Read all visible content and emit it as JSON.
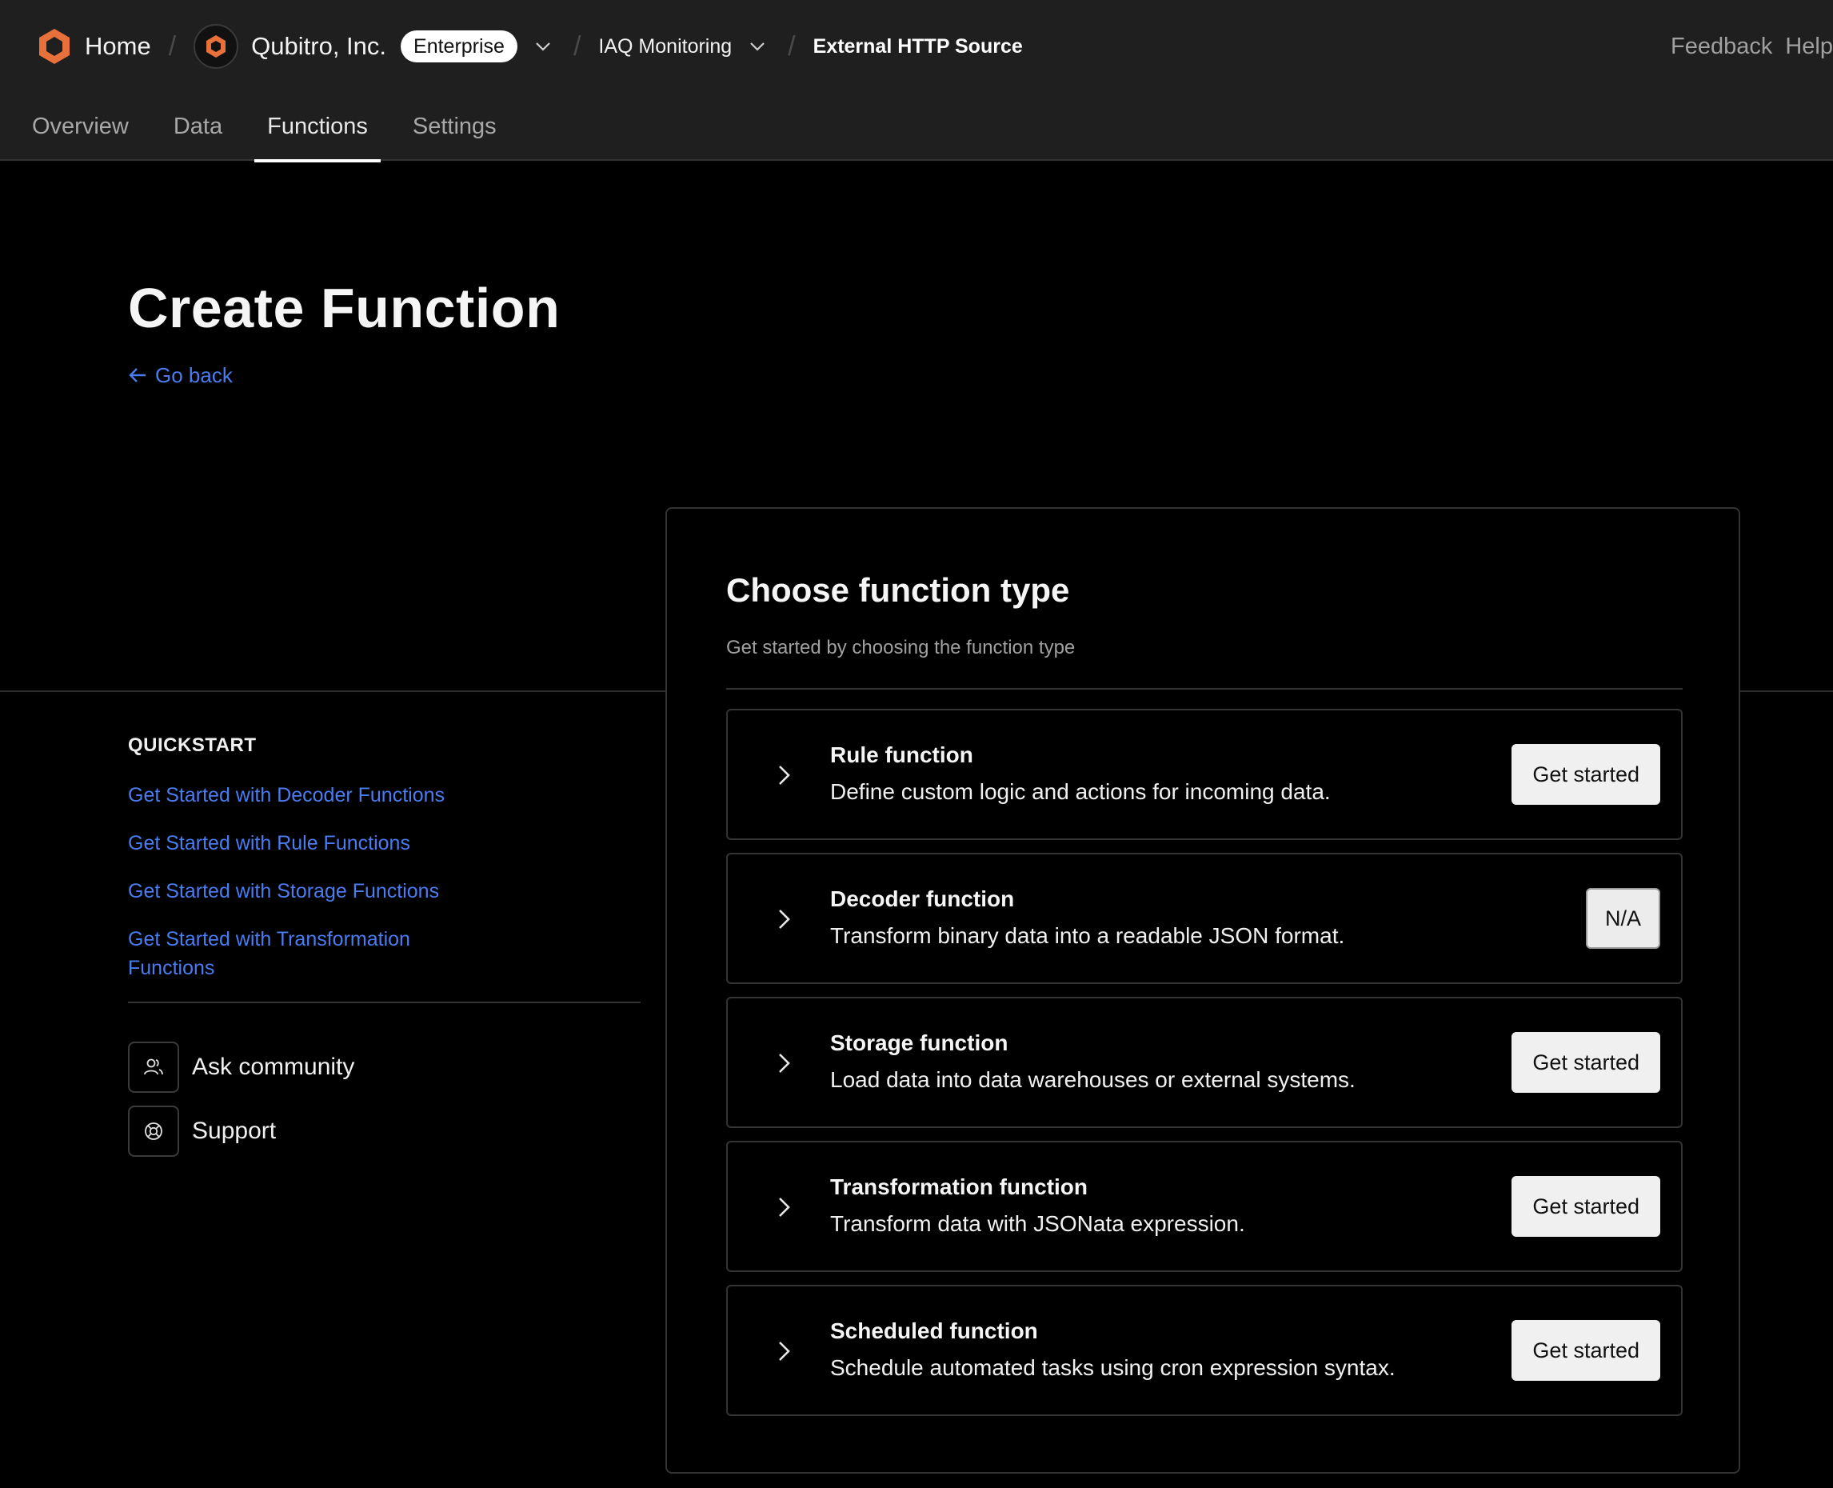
{
  "header": {
    "home_label": "Home",
    "org_name": "Qubitro, Inc.",
    "plan_badge": "Enterprise",
    "project_name": "IAQ Monitoring",
    "source_name": "External HTTP Source",
    "separator": "/",
    "feedback_label": "Feedback",
    "help_label": "Help",
    "brand_color": "#E8703A"
  },
  "tabs": [
    {
      "label": "Overview",
      "active": false
    },
    {
      "label": "Data",
      "active": false
    },
    {
      "label": "Functions",
      "active": true
    },
    {
      "label": "Settings",
      "active": false
    }
  ],
  "page": {
    "title": "Create Function",
    "go_back_label": "Go back",
    "link_color": "#4A7CF0"
  },
  "sidebar": {
    "quickstart_title": "QUICKSTART",
    "links": [
      "Get Started with Decoder Functions",
      "Get Started with Rule Functions",
      "Get Started with Storage Functions",
      "Get Started with Transformation Functions"
    ],
    "ask_community_label": "Ask community",
    "support_label": "Support"
  },
  "card": {
    "title": "Choose function type",
    "subtitle": "Get started by choosing the function type",
    "functions": [
      {
        "name": "Rule function",
        "description": "Define custom logic and actions for incoming data.",
        "action": "Get started"
      },
      {
        "name": "Decoder function",
        "description": "Transform binary data into a readable JSON format.",
        "action": "N/A"
      },
      {
        "name": "Storage function",
        "description": "Load data into data warehouses or external systems.",
        "action": "Get started"
      },
      {
        "name": "Transformation function",
        "description": "Transform data with JSONata expression.",
        "action": "Get started"
      },
      {
        "name": "Scheduled function",
        "description": "Schedule automated tasks using cron expression syntax.",
        "action": "Get started"
      }
    ]
  }
}
